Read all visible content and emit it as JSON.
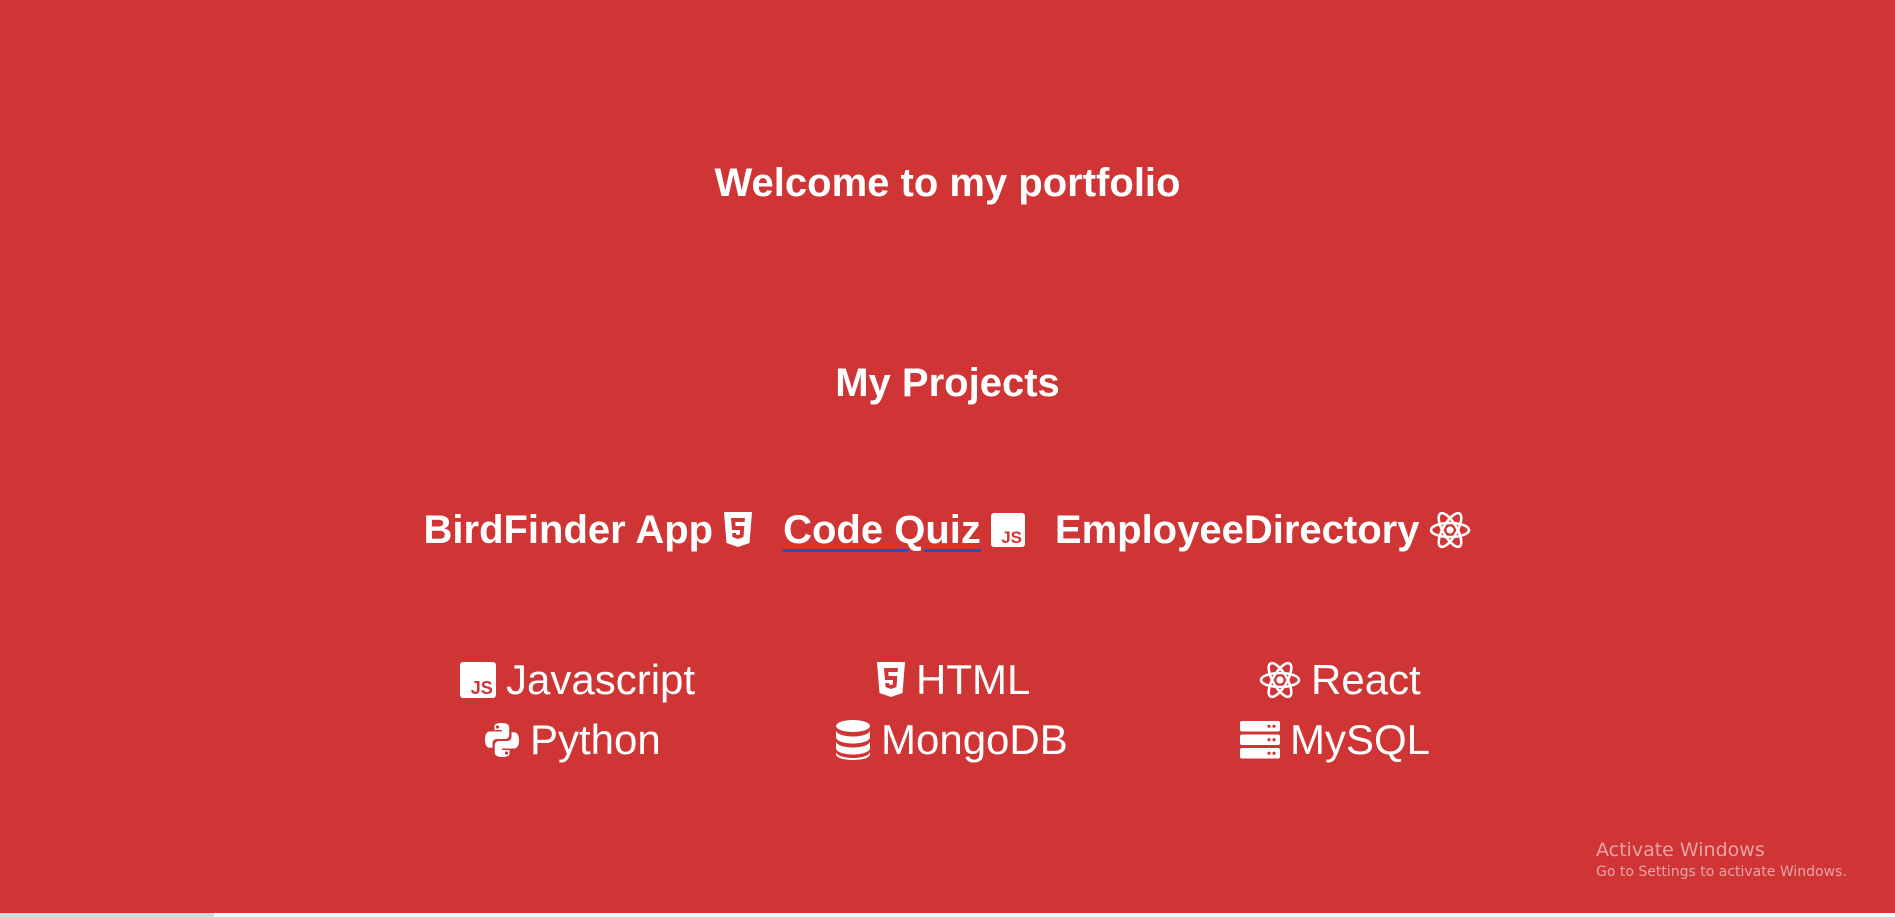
{
  "header": {
    "welcome": "Welcome to my portfolio"
  },
  "projects": {
    "title": "My Projects",
    "items": [
      {
        "label": "BirdFinder App",
        "icon": "html5-icon"
      },
      {
        "label": "Code Quiz",
        "icon": "js-icon"
      },
      {
        "label": "EmployeeDirectory",
        "icon": "react-icon"
      }
    ]
  },
  "skills": {
    "items": [
      {
        "label": "Javascript",
        "icon": "js-icon"
      },
      {
        "label": "HTML",
        "icon": "html5-icon"
      },
      {
        "label": "React",
        "icon": "react-icon"
      },
      {
        "label": "Python",
        "icon": "python-icon"
      },
      {
        "label": "MongoDB",
        "icon": "database-icon"
      },
      {
        "label": "MySQL",
        "icon": "server-icon"
      }
    ]
  },
  "system": {
    "activate_title": "Activate Windows",
    "activate_sub": "Go to Settings to activate Windows."
  },
  "colors": {
    "background": "#cf3535",
    "text": "#ffffff",
    "underline": "#2b4fb8"
  }
}
